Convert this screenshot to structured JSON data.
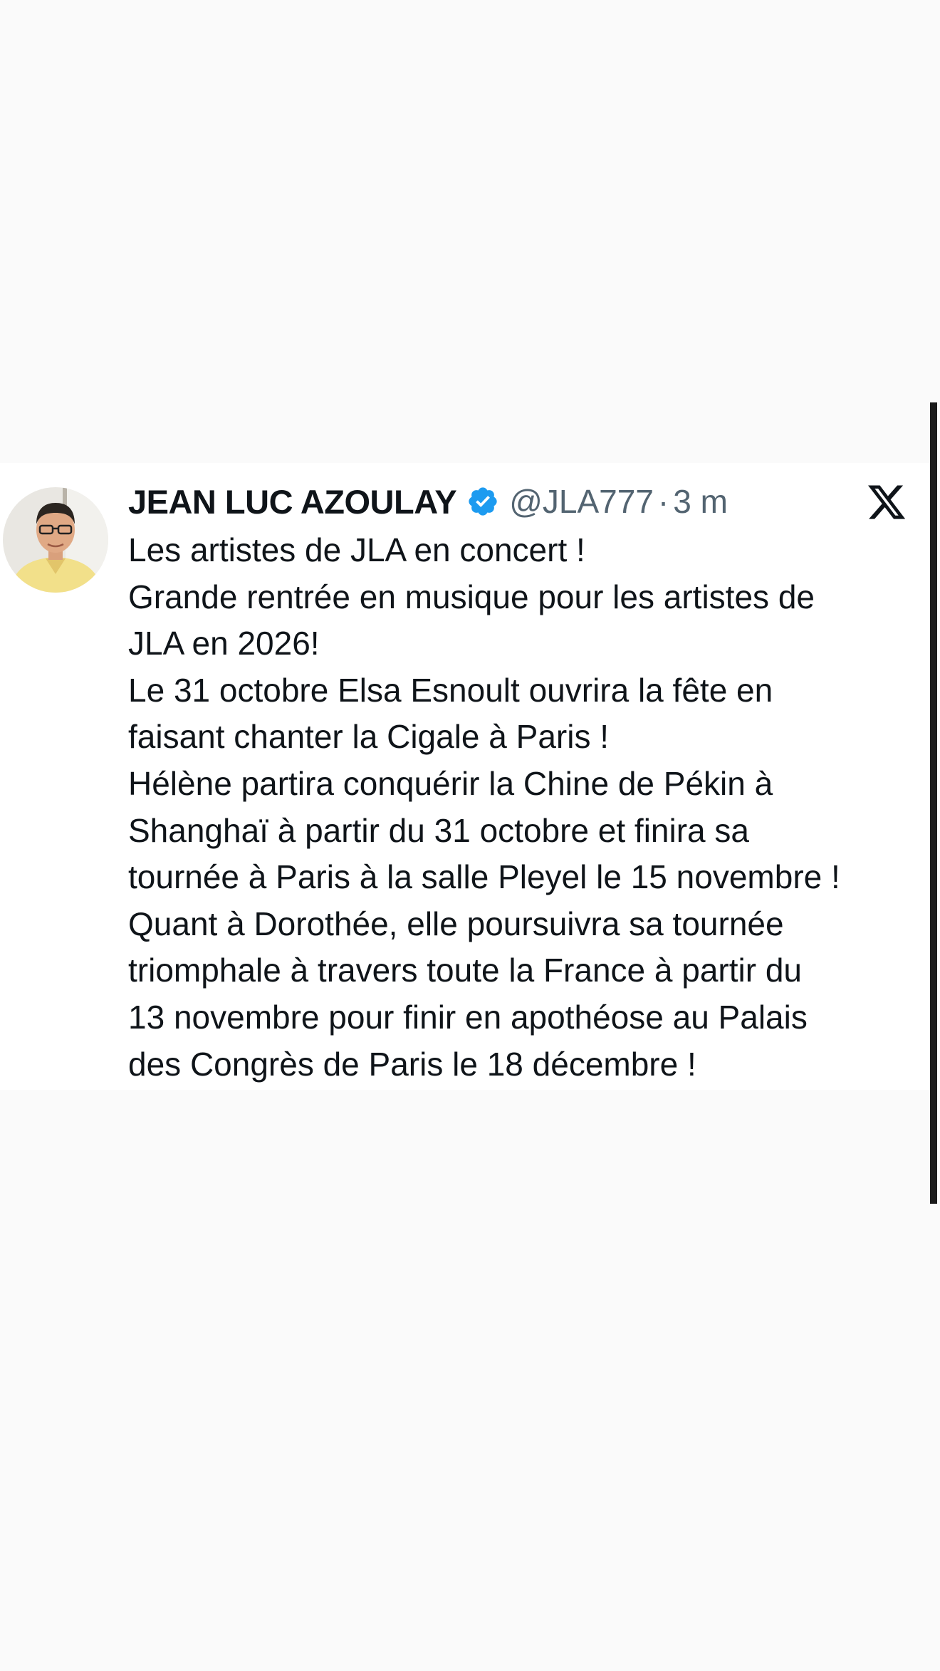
{
  "post": {
    "author_name": "JEAN LUC AZOULAY",
    "handle": "@JLA777",
    "separator": "·",
    "time": "3 m",
    "verified": true,
    "platform_icon": "x-logo-icon",
    "verified_icon": "verified-badge-icon",
    "lines": [
      "Les artistes de JLA en concert !",
      "Grande rentrée en musique pour les artistes de",
      "JLA en 2026!",
      "Le 31 octobre Elsa Esnoult ouvrira la fête en",
      "faisant chanter la Cigale à Paris !",
      "Hélène partira conquérir la Chine de Pékin à",
      "Shanghaï à partir du 31 octobre et finira sa",
      "tournée à Paris à la salle Pleyel le 15 novembre !",
      "Quant à Dorothée, elle poursuivra sa tournée",
      "triomphale à travers toute la France à partir du",
      "13 novembre pour finir en apothéose au Palais",
      "des Congrès de Paris le 18 décembre !"
    ]
  },
  "colors": {
    "background": "#fafafa",
    "card": "#ffffff",
    "text": "#0f1419",
    "secondary_text": "#536471",
    "verified_blue": "#1d9bf0"
  }
}
